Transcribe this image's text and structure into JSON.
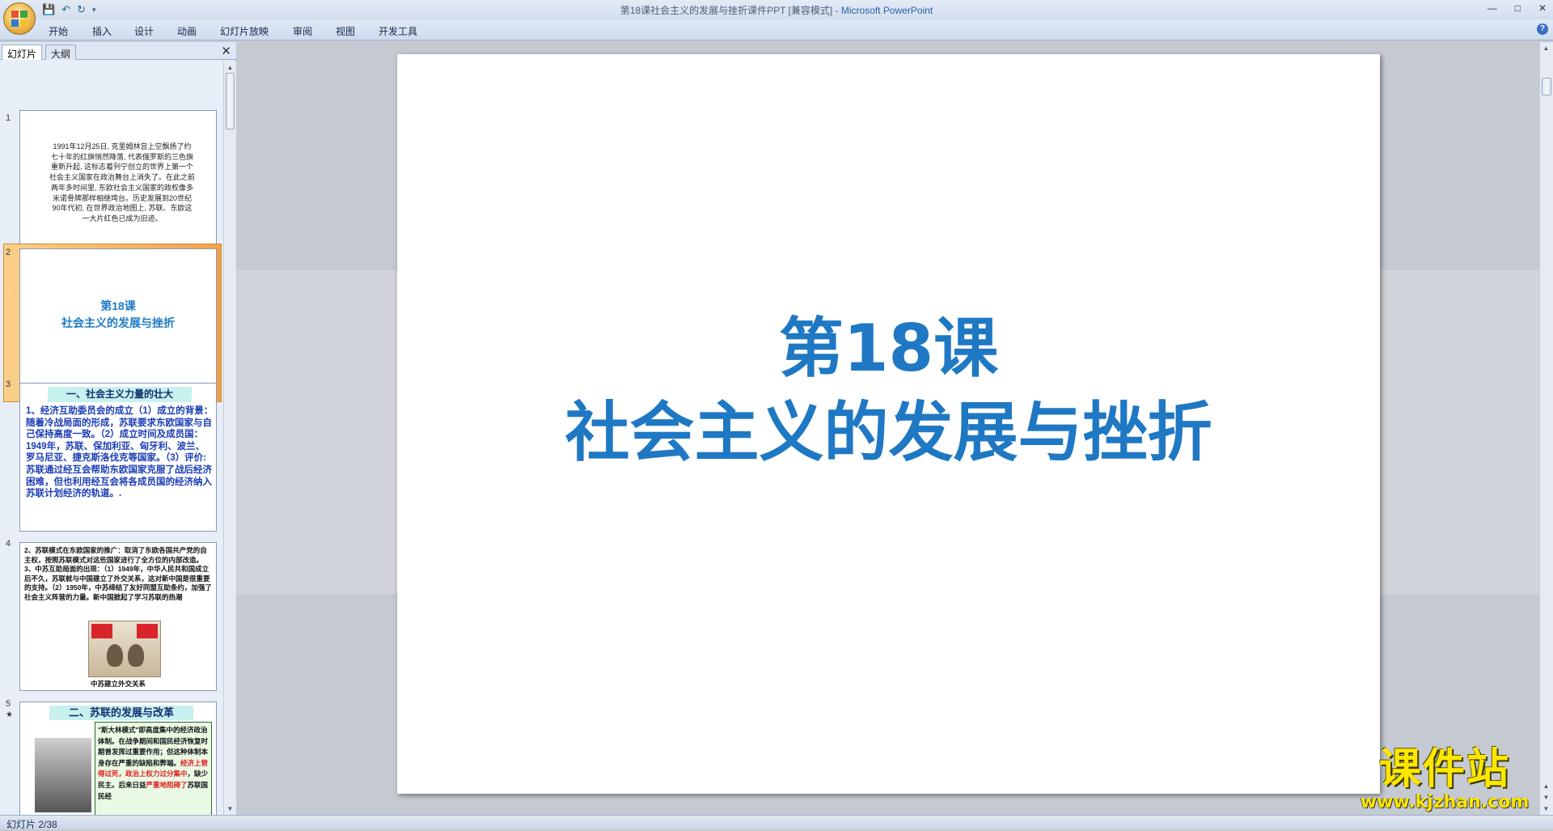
{
  "window": {
    "title_doc": "第18课社会主义的发展与挫折课件PPT [兼容模式]",
    "title_sep": " - ",
    "title_app": "Microsoft PowerPoint"
  },
  "ribbon": {
    "tabs": [
      "开始",
      "插入",
      "设计",
      "动画",
      "幻灯片放映",
      "审阅",
      "视图",
      "开发工具"
    ]
  },
  "panel": {
    "tab_slides": "幻灯片",
    "tab_outline": "大纲",
    "slide_numbers": [
      "1",
      "2",
      "3",
      "4",
      "5"
    ]
  },
  "thumbs": {
    "s1_text": "1991年12月25日, 克里姆林宫上空飘扬了约七十年的红旗悄然降落, 代表俄罗斯的三色旗重新升起, 这标志着列宁创立的世界上第一个社会主义国家在政治舞台上消失了。在此之前两年多时间里, 东欧社会主义国家的政权像多米诺骨牌那样相继垮台。历史发展到20世纪90年代初, 在世界政治地图上, 苏联、东欧这一大片红色已成为旧迹。",
    "s2_line1": "第18课",
    "s2_line2": "社会主义的发展与挫折",
    "s3_head": "一、社会主义力量的壮大",
    "s3_body": "1、经济互助委员会的成立（1）成立的背景：随着冷战局面的形成，苏联要求东欧国家与自己保持高度一致。（2）成立时间及成员国：1949年，苏联、保加利亚、匈牙利、波兰、罗马尼亚、捷克斯洛伐克等国家。（3）评价:苏联通过经互会帮助东欧国家克服了战后经济困难，但也利用经互会将各成员国的经济纳入苏联计划经济的轨道。.",
    "s4_body": "2、苏联模式在东欧国家的推广：取消了东欧各国共产党的自主权，按照苏联模式对这些国家进行了全方位的内部改造。3、中苏互助局面的出现：（1）1949年，中华人民共和国成立后不久，苏联就与中国建立了外交关系，这对新中国是很重要的支持。（2）1950年，中苏缔结了友好同盟互助条约，加强了社会主义阵营的力量。新中国掀起了学习苏联的热潮",
    "s4_caption": "中苏建立外交关系",
    "s5_head": "二、苏联的发展与改革",
    "s5_box_a": "\"斯大林模式\"即高度集中的经济政治体制。在战争期间和国民经济恢复时期曾发挥过重要作用；但这种体制本身存在严重的缺陷和弊端。",
    "s5_box_red1": "经济上管得过死，政治上权力过分集中",
    "s5_box_b": "，缺少民主。后来日益",
    "s5_box_red2": "严重地阻碍了",
    "s5_box_c": "苏联国民经"
  },
  "slide": {
    "line1": "第18课",
    "line2": "社会主义的发展与挫折",
    "color": "#1f78c3"
  },
  "status": {
    "text": "幻灯片 2/38"
  },
  "watermark": {
    "title": "课件站",
    "url": "www.kjzhan.com"
  }
}
